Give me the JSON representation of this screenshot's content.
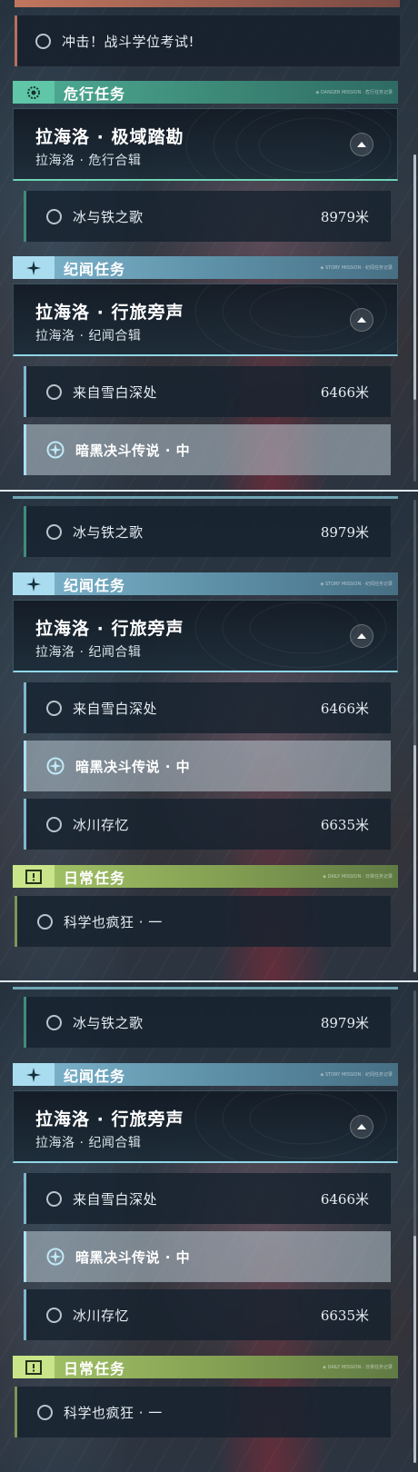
{
  "sections": {
    "danger": {
      "title": "危行任务",
      "tag": "◈ DANGER MISSION · 危行任务记录",
      "color": "#4fae96"
    },
    "story": {
      "title": "纪闻任务",
      "tag": "◈ STORY MISSION · 纪闻任务记录",
      "color": "#7fb7cf"
    },
    "daily": {
      "title": "日常任务",
      "tag": "◈ DAILY MISSION · 日常任务记录",
      "color": "#a7c86a"
    }
  },
  "quests": {
    "top_quest": "冲击！战斗学位考试!",
    "danger_card": {
      "title": "拉海洛 · 极域踏勘",
      "subtitle": "拉海洛 · 危行合辑"
    },
    "story_card": {
      "title": "拉海洛 · 行旅旁声",
      "subtitle": "拉海洛 · 纪闻合辑"
    },
    "ice_iron": {
      "label": "冰与铁之歌",
      "distance": "8979米"
    },
    "snow_deep": {
      "label": "来自雪白深处",
      "distance": "6466米"
    },
    "dark_duel": {
      "label": "暗黑决斗传说 · 中"
    },
    "glacier": {
      "label": "冰川存忆",
      "distance": "6635米"
    },
    "science": {
      "label": "科学也疯狂 · 一"
    }
  },
  "icons": {
    "danger": "eye-gear-icon",
    "story": "sparkle-icon",
    "daily": "exclamation-icon",
    "collapse": "chevron-up-icon",
    "track": "target-icon"
  },
  "accent_colors": {
    "selected_border": "#a9e0f2",
    "card_underline": "#8fd6e6"
  }
}
